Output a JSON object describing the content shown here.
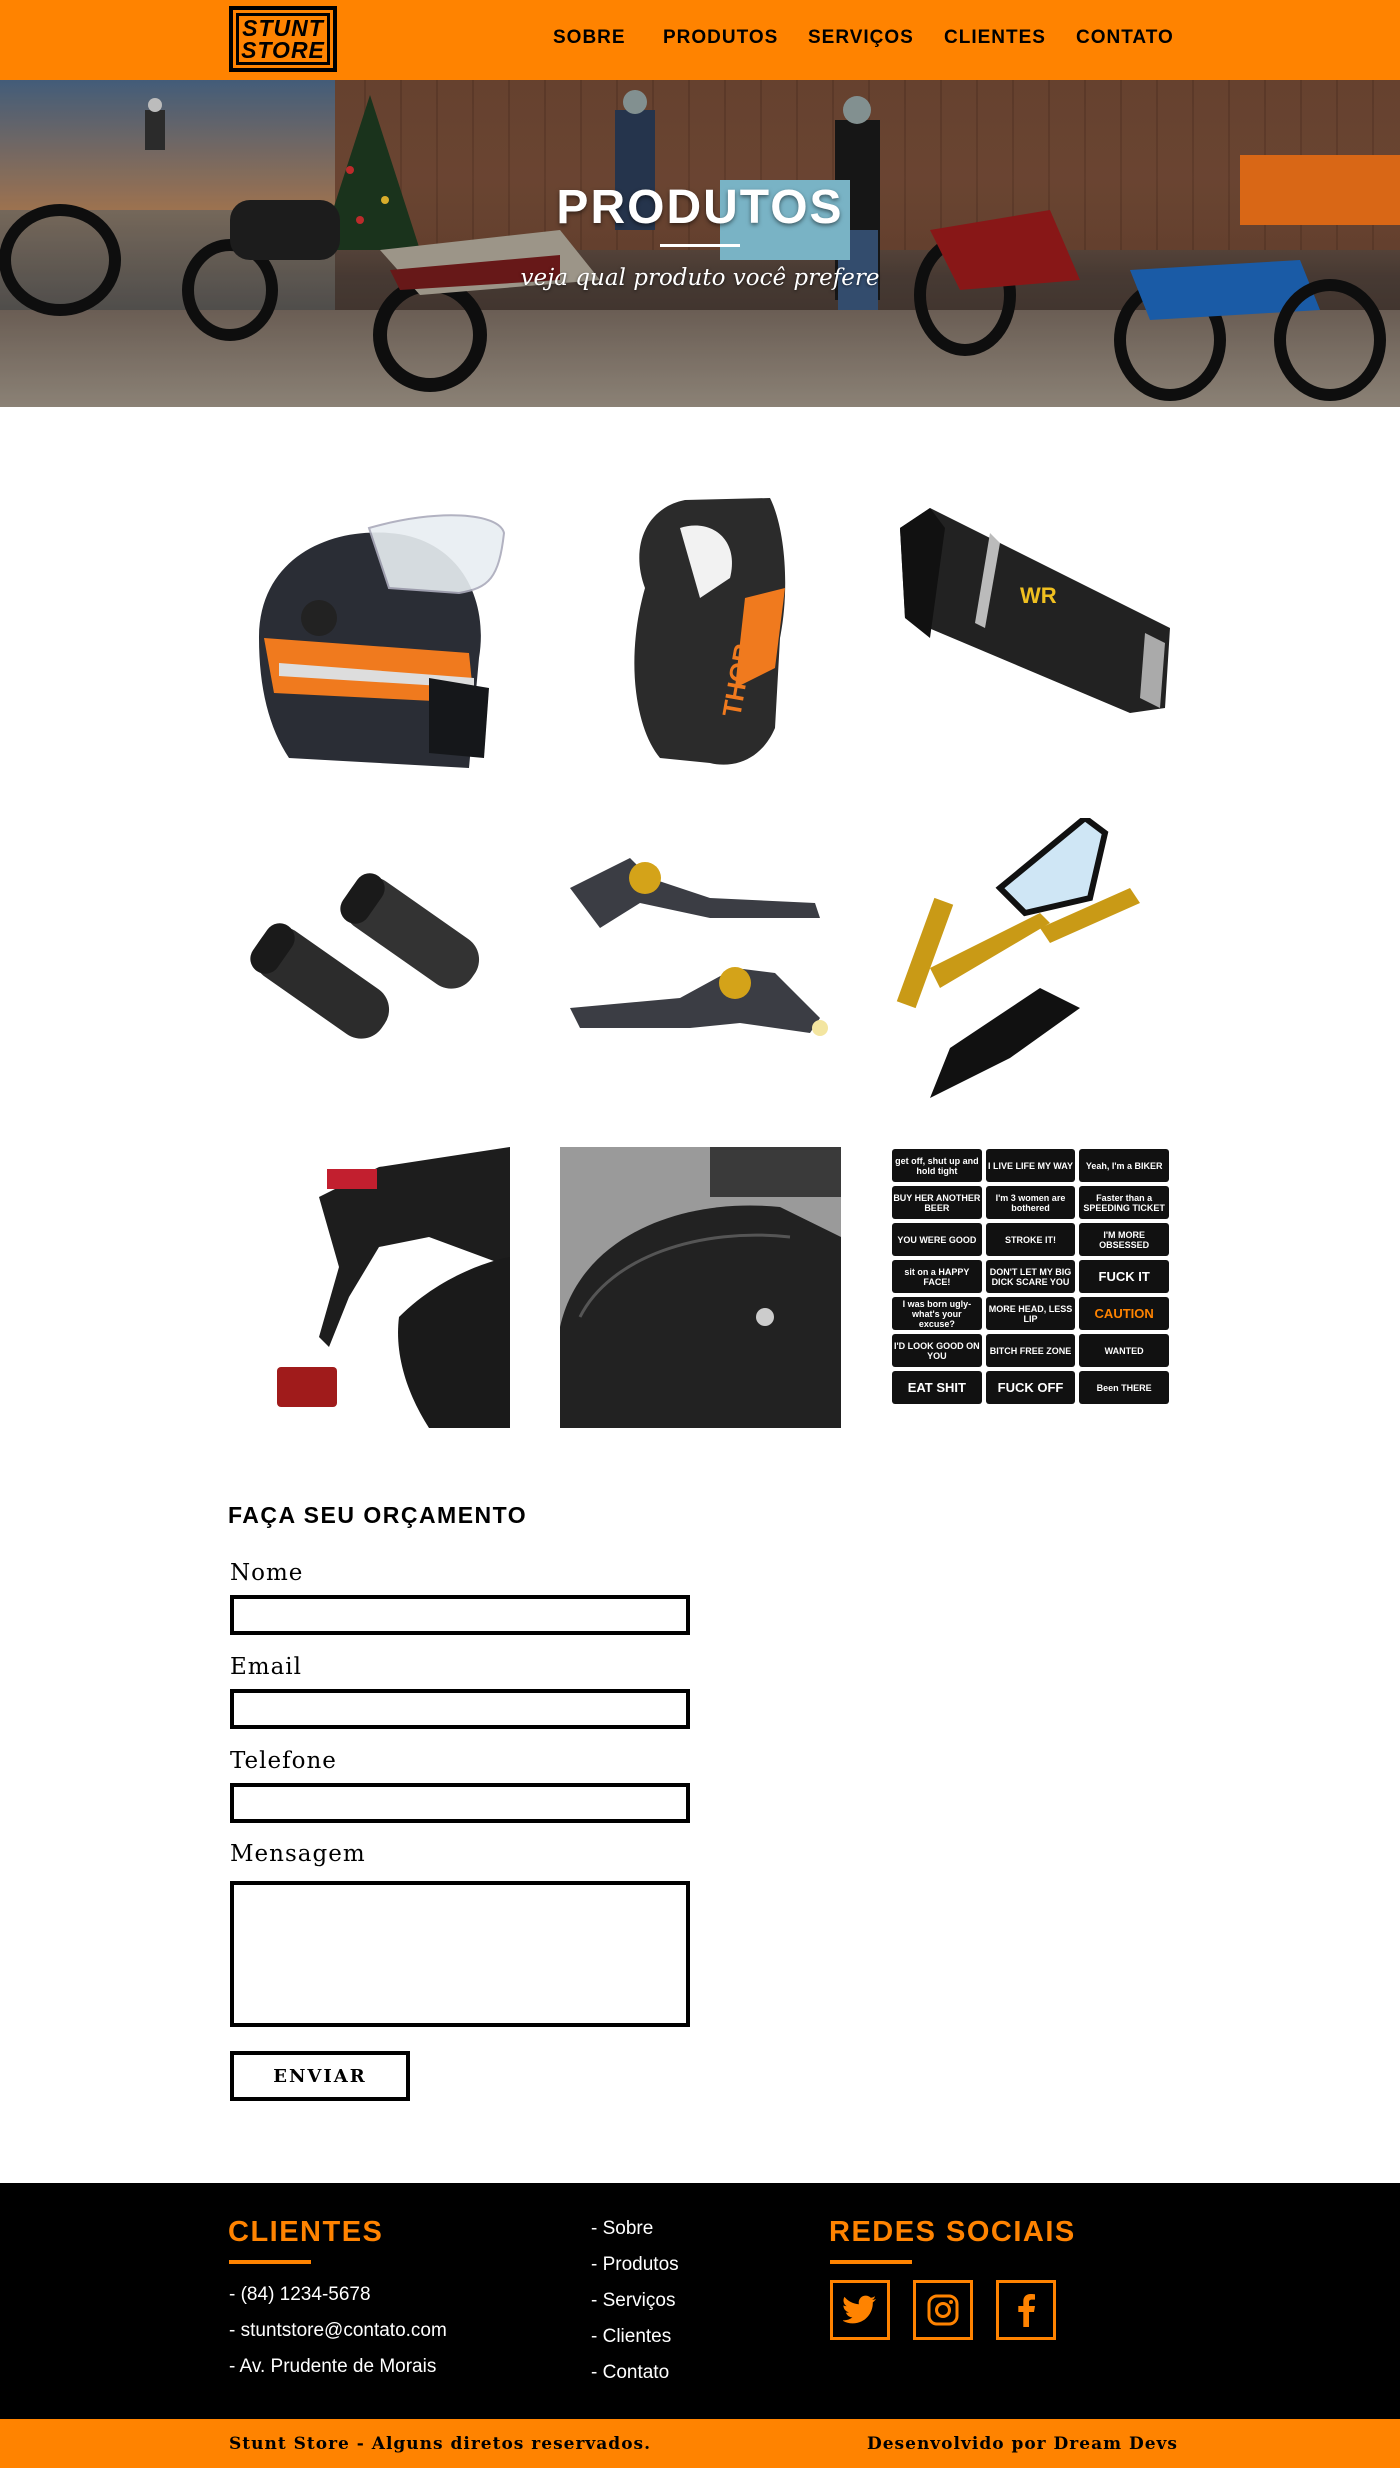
{
  "header": {
    "logo_line1": "STUNT",
    "logo_line2": "STORE",
    "nav": [
      "SOBRE",
      "PRODUTOS",
      "SERVIÇOS",
      "CLIENTES",
      "CONTATO"
    ]
  },
  "hero": {
    "title": "PRODUTOS",
    "subtitle": "veja qual produto você prefere"
  },
  "products": [
    {
      "name": "helmet",
      "icon": "helmet-icon"
    },
    {
      "name": "glove",
      "icon": "glove-icon"
    },
    {
      "name": "exhaust",
      "icon": "exhaust-icon"
    },
    {
      "name": "grips",
      "icon": "grips-icon"
    },
    {
      "name": "levers",
      "icon": "levers-icon"
    },
    {
      "name": "mirrors",
      "icon": "mirrors-icon"
    },
    {
      "name": "plate-holder",
      "icon": "plate-holder-icon"
    },
    {
      "name": "carbon-tank",
      "icon": "carbon-tank-icon"
    },
    {
      "name": "stickers",
      "icon": "stickers-icon",
      "sticker_texts": [
        "get off, shut up and hold tight",
        "I LIVE LIFE MY WAY",
        "Yeah, I'm a BIKER",
        "BUY HER ANOTHER BEER",
        "I'm 3 women are bothered",
        "Faster than a SPEEDING TICKET",
        "YOU WERE GOOD",
        "STROKE IT!",
        "I'M MORE OBSESSED",
        "sit on a HAPPY FACE!",
        "DON'T LET MY BIG DICK SCARE YOU",
        "FUCK IT",
        "I was born ugly- what's your excuse?",
        "MORE HEAD, LESS LIP",
        "CAUTION",
        "I'D LOOK GOOD ON YOU",
        "BITCH FREE ZONE",
        "WANTED",
        "EAT SHIT",
        "FUCK OFF",
        "Been THERE"
      ]
    }
  ],
  "form": {
    "title": "FAÇA SEU ORÇAMENTO",
    "name_label": "Nome",
    "email_label": "Email",
    "phone_label": "Telefone",
    "message_label": "Mensagem",
    "name_value": "",
    "email_value": "",
    "phone_value": "",
    "message_value": "",
    "submit_label": "ENVIAR"
  },
  "footer": {
    "clients_title": "CLIENTES",
    "phone": "- (84) 1234-5678",
    "email": "- stuntstore@contato.com",
    "address": "- Av. Prudente de Morais",
    "links": [
      "- Sobre",
      "- Produtos",
      "- Serviços",
      "- Clientes",
      "- Contato"
    ],
    "social_title": "REDES SOCIAIS",
    "social_icons": [
      "twitter-icon",
      "instagram-icon",
      "facebook-icon"
    ],
    "copyright": "Stunt Store - Alguns diretos reservados.",
    "credit": "Desenvolvido por Dream Devs"
  },
  "colors": {
    "brand_orange": "#ff8300",
    "black": "#000000",
    "white": "#ffffff"
  }
}
